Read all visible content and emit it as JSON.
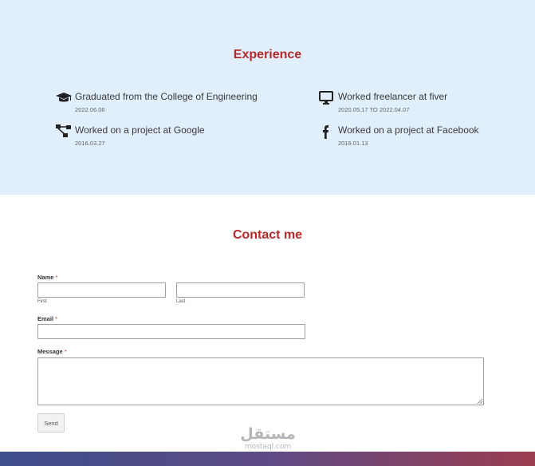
{
  "experience": {
    "title": "Experience",
    "items": [
      {
        "icon": "graduation-cap-icon",
        "text": "Graduated from the College of Engineering",
        "date": "2022.06.06"
      },
      {
        "icon": "desktop-icon",
        "text": "Worked freelancer at fiver",
        "date": "2020.05.17 TO 2022.04.07"
      },
      {
        "icon": "sitemap-icon",
        "text": "Worked on a project at Google",
        "date": "2016.03.27"
      },
      {
        "icon": "facebook-icon",
        "text": "Worked on a project at Facebook",
        "date": "2019.01.13"
      }
    ]
  },
  "contact": {
    "title": "Contact me",
    "name_label": "Name",
    "required_mark": "*",
    "first_label": "First",
    "last_label": "Last",
    "email_label": "Email",
    "message_label": "Message",
    "send_label": "Send"
  },
  "watermark": {
    "main": "مستقل",
    "sub": "mostaql.com"
  },
  "colors": {
    "experience_bg": "#e1eefc",
    "title_red": "#b5292b",
    "footer_start": "#3e4f8c",
    "footer_end": "#9b3d4e"
  }
}
